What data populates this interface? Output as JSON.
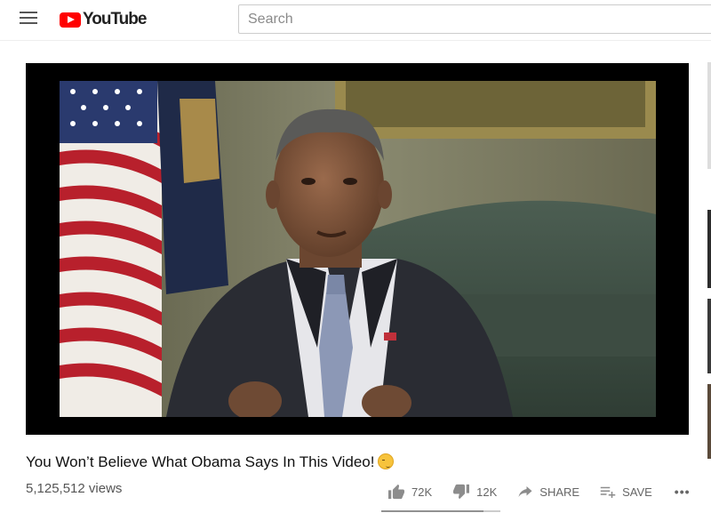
{
  "header": {
    "logo_text": "YouTube",
    "search_placeholder": "Search"
  },
  "video": {
    "title": "You Won’t Believe What Obama Says In This Video!",
    "title_emoji": "winking-face",
    "views": "5,125,512 views",
    "likes": "72K",
    "dislikes": "12K",
    "share_label": "SHARE",
    "save_label": "SAVE",
    "more_label": "•••",
    "like_ratio": 0.86
  },
  "colors": {
    "brand_red": "#ff0000",
    "text_primary": "#111111",
    "text_secondary": "#606060"
  },
  "icons": [
    "menu-icon",
    "youtube-logo-icon",
    "thumbs-up-icon",
    "thumbs-down-icon",
    "share-arrow-icon",
    "playlist-add-icon",
    "more-icon",
    "winking-face-emoji-icon"
  ]
}
